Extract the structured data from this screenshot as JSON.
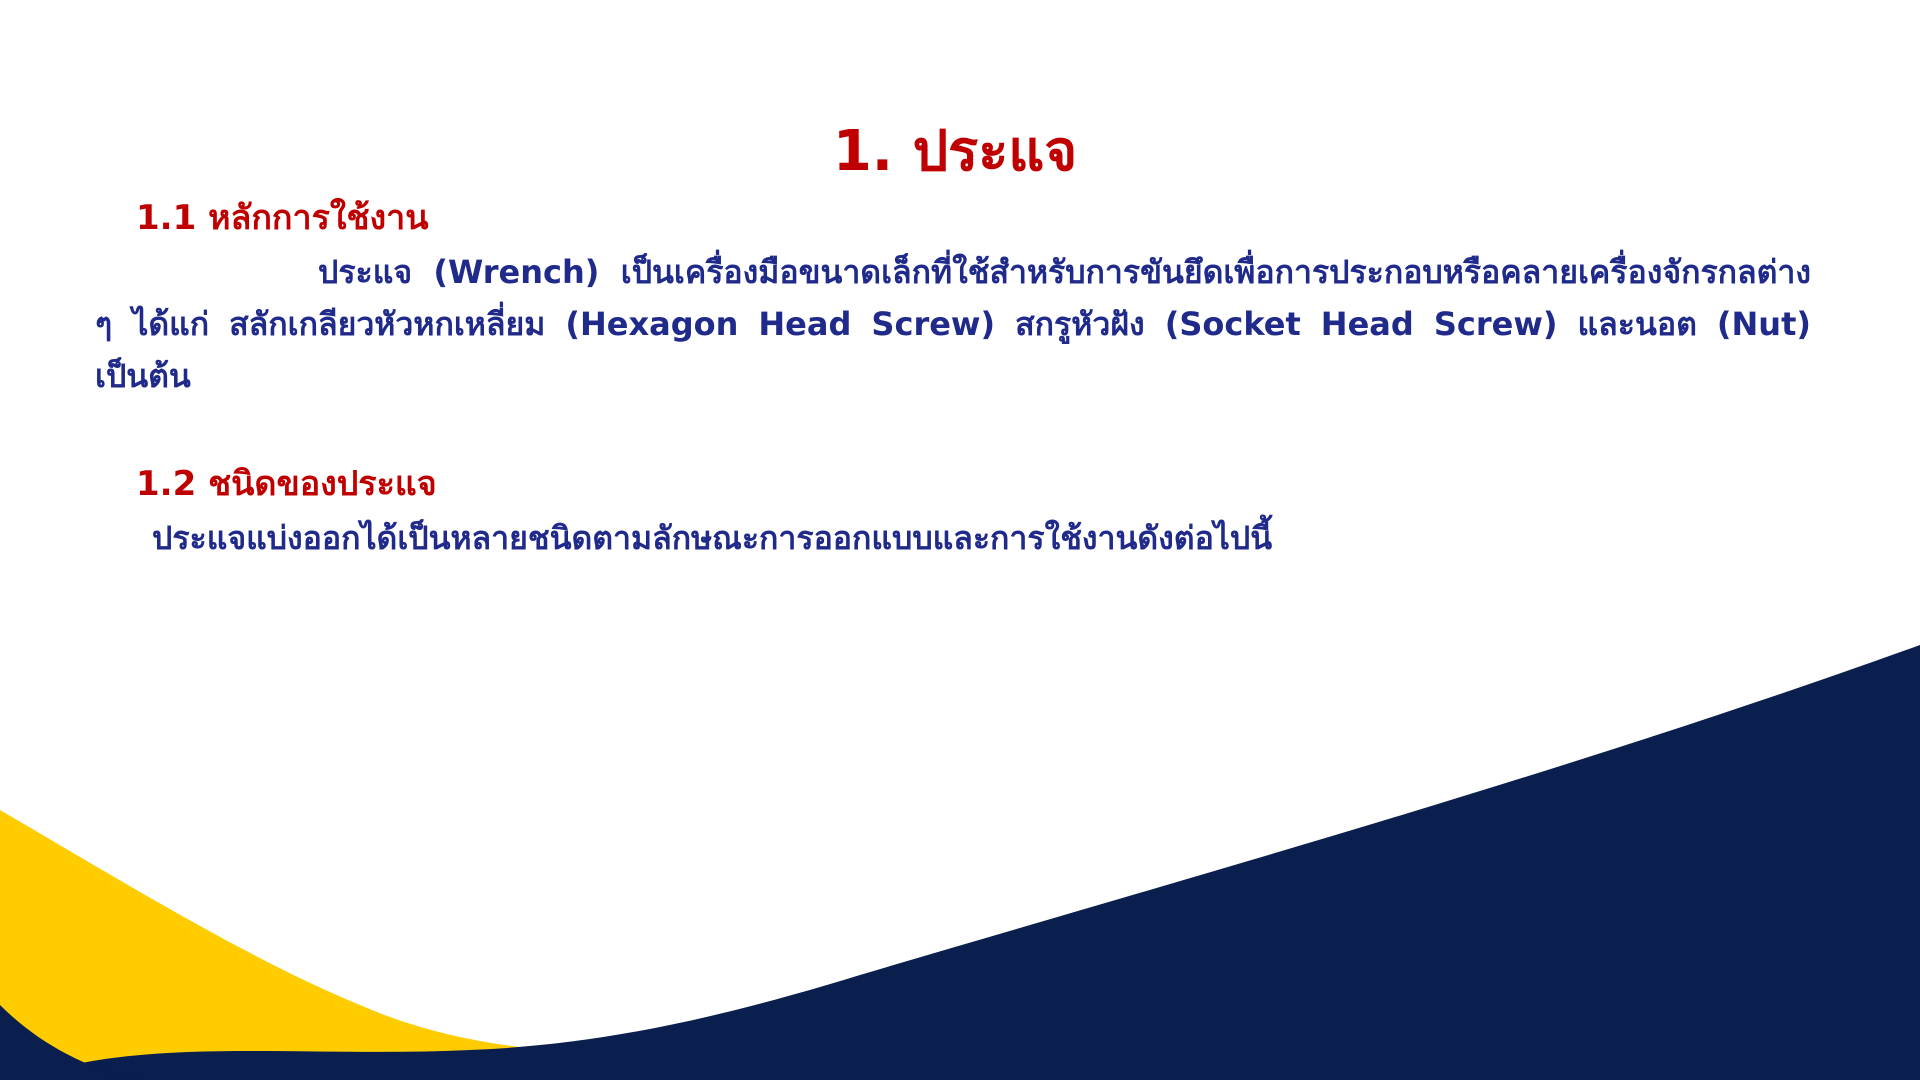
{
  "title": "1. ประแจ",
  "section_1_1": {
    "heading": "1.1 หลักการใช้งาน",
    "body": "ประแจ (Wrench) เป็นเครื่องมือขนาดเล็กที่ใช้สำหรับการขันยึดเพื่อการประกอบหรือคลายเครื่องจักรกลต่าง ๆ ได้แก่ สลักเกลียวหัวหกเหลี่ยม (Hexagon Head Screw) สกรูหัวฝัง (Socket Head Screw) และนอต (Nut) เป็นต้น"
  },
  "section_1_2": {
    "heading": "1.2 ชนิดของประแจ",
    "body": "ประแจแบ่งออกได้เป็นหลายชนิดตามลักษณะการออกแบบและการใช้งานดังต่อไปนี้"
  },
  "colors": {
    "heading_red": "#c00000",
    "body_navy": "#1f2a8a",
    "wave_navy": "#0a1f4e",
    "wave_yellow": "#ffcc00",
    "background": "#ffffff"
  }
}
